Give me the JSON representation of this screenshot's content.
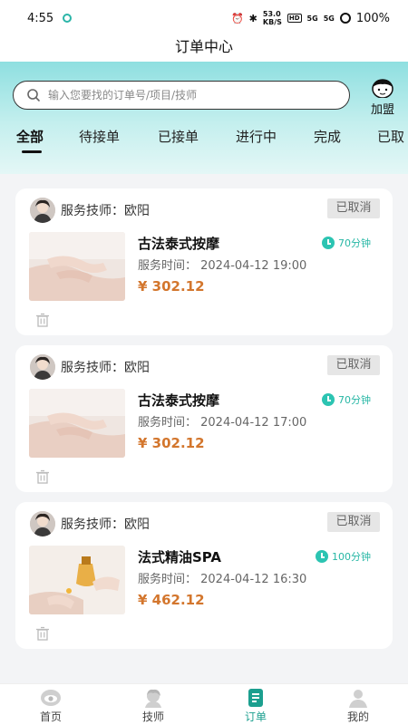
{
  "status_bar": {
    "time": "4:55",
    "net_speed_top": "53.0",
    "net_speed_unit": "KB/S",
    "hd": "HD",
    "sig1": "5G",
    "sig2": "5G",
    "battery": "100%"
  },
  "header": {
    "title": "订单中心"
  },
  "search": {
    "placeholder": "输入您要找的订单号/项目/技师"
  },
  "join": {
    "label": "加盟"
  },
  "tabs": [
    {
      "label": "全部",
      "active": true
    },
    {
      "label": "待接单"
    },
    {
      "label": "已接单"
    },
    {
      "label": "进行中"
    },
    {
      "label": "完成"
    },
    {
      "label": "已取"
    }
  ],
  "orders": [
    {
      "technician": "服务技师：欧阳",
      "status": "已取消",
      "service": "古法泰式按摩",
      "duration": "70分钟",
      "time": "服务时间：  2024-04-12 19:00",
      "price": "¥ 302.12"
    },
    {
      "technician": "服务技师：欧阳",
      "status": "已取消",
      "service": "古法泰式按摩",
      "duration": "70分钟",
      "time": "服务时间：  2024-04-12 17:00",
      "price": "¥ 302.12"
    },
    {
      "technician": "服务技师：欧阳",
      "status": "已取消",
      "service": "法式精油SPA",
      "duration": "100分钟",
      "time": "服务时间：  2024-04-12 16:30",
      "price": "¥ 462.12"
    }
  ],
  "nav": [
    {
      "label": "首页",
      "icon": "home-eye-icon"
    },
    {
      "label": "技师",
      "icon": "technician-icon"
    },
    {
      "label": "订单",
      "icon": "order-icon",
      "active": true
    },
    {
      "label": "我的",
      "icon": "profile-icon"
    }
  ],
  "colors": {
    "accent": "#1b9f8f",
    "price": "#d3762d",
    "header_gradient_top": "#8edfe0"
  }
}
